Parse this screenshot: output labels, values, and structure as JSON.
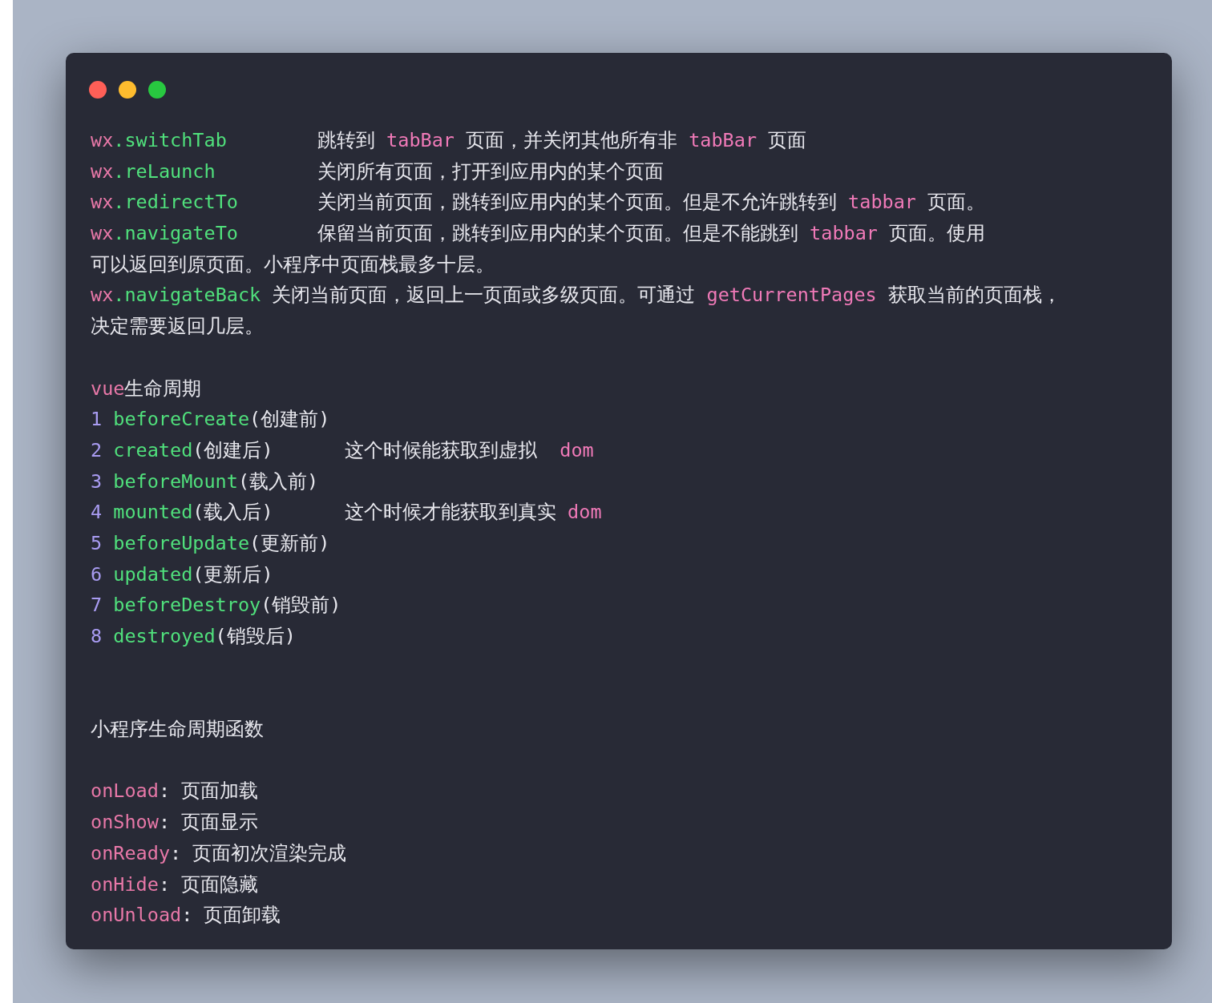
{
  "window": {
    "controls": [
      {
        "color": "#ff5f57"
      },
      {
        "color": "#febc2e"
      },
      {
        "color": "#28c840"
      }
    ]
  },
  "lines": [
    {
      "kind": "api",
      "lead": [
        {
          "text": "wx",
          "kind": "object"
        },
        {
          "text": ".switchTab",
          "kind": "method"
        }
      ],
      "rest": [
        {
          "text": "跳转到",
          "kind": "text"
        },
        {
          "text": "tabBar",
          "kind": "code"
        },
        {
          "text": "页面，并关闭其他所有非",
          "kind": "text"
        },
        {
          "text": "tabBar",
          "kind": "code"
        },
        {
          "text": "页面",
          "kind": "text"
        }
      ]
    },
    {
      "kind": "api",
      "lead": [
        {
          "text": "wx",
          "kind": "object"
        },
        {
          "text": ".reLaunch",
          "kind": "method"
        }
      ],
      "rest": [
        {
          "text": "关闭所有页面，打开到应用内的某个页面",
          "kind": "text"
        }
      ]
    },
    {
      "kind": "api",
      "lead": [
        {
          "text": "wx",
          "kind": "object"
        },
        {
          "text": ".redirectTo",
          "kind": "method"
        }
      ],
      "rest": [
        {
          "text": "关闭当前页面，跳转到应用内的某个页面。但是不允许跳转到",
          "kind": "text"
        },
        {
          "text": "tabbar",
          "kind": "code"
        },
        {
          "text": "页面。",
          "kind": "text"
        }
      ]
    },
    {
      "kind": "api",
      "lead": [
        {
          "text": "wx",
          "kind": "object"
        },
        {
          "text": ".navigateTo",
          "kind": "method"
        }
      ],
      "rest": [
        {
          "text": "保留当前页面，跳转到应用内的某个页面。但是不能跳到",
          "kind": "text"
        },
        {
          "text": "tabbar",
          "kind": "code"
        },
        {
          "text": "页面。使用",
          "kind": "text"
        }
      ]
    },
    {
      "kind": "plain",
      "lead": [
        {
          "text": "可以返回到原页面。小程序中页面栈最多十层。",
          "kind": "text"
        }
      ]
    },
    {
      "kind": "plain",
      "lead": [
        {
          "text": "wx",
          "kind": "object"
        },
        {
          "text": ".navigateBack",
          "kind": "method"
        },
        {
          "text": " 关闭当前页面，返回上一页面或多级页面。可通过",
          "kind": "text"
        },
        {
          "text": "getCurrentPages",
          "kind": "code"
        },
        {
          "text": "获取当前的页面栈，",
          "kind": "text"
        }
      ]
    },
    {
      "kind": "plain",
      "lead": [
        {
          "text": "决定需要返回几层。",
          "kind": "text"
        }
      ]
    },
    {
      "kind": "blank"
    },
    {
      "kind": "plain",
      "lead": [
        {
          "text": "vue",
          "kind": "object"
        },
        {
          "text": "生命周期",
          "kind": "text"
        }
      ]
    },
    {
      "kind": "hook",
      "lead": [
        {
          "text": "1",
          "kind": "index"
        },
        {
          "text": "beforeCreate",
          "kind": "method"
        },
        {
          "text": "(创建前)",
          "kind": "text"
        }
      ]
    },
    {
      "kind": "hook",
      "lead": [
        {
          "text": "2",
          "kind": "index"
        },
        {
          "text": "created",
          "kind": "method"
        },
        {
          "text": "(创建后)",
          "kind": "text"
        }
      ],
      "rest": [
        {
          "text": "这个时候能获取到虚拟 ",
          "kind": "text"
        },
        {
          "text": "dom",
          "kind": "code"
        }
      ]
    },
    {
      "kind": "hook",
      "lead": [
        {
          "text": "3",
          "kind": "index"
        },
        {
          "text": "beforeMount",
          "kind": "method"
        },
        {
          "text": "(载入前)",
          "kind": "text"
        }
      ]
    },
    {
      "kind": "hook",
      "lead": [
        {
          "text": "4",
          "kind": "index"
        },
        {
          "text": "mounted",
          "kind": "method"
        },
        {
          "text": "(载入后)",
          "kind": "text"
        }
      ],
      "rest": [
        {
          "text": "这个时候才能获取到真实",
          "kind": "text"
        },
        {
          "text": "dom",
          "kind": "code"
        }
      ]
    },
    {
      "kind": "hook",
      "lead": [
        {
          "text": "5",
          "kind": "index"
        },
        {
          "text": "beforeUpdate",
          "kind": "method"
        },
        {
          "text": "(更新前)",
          "kind": "text"
        }
      ]
    },
    {
      "kind": "hook",
      "lead": [
        {
          "text": "6",
          "kind": "index"
        },
        {
          "text": "updated",
          "kind": "method"
        },
        {
          "text": "(更新后)",
          "kind": "text"
        }
      ]
    },
    {
      "kind": "hook",
      "lead": [
        {
          "text": "7",
          "kind": "index"
        },
        {
          "text": "beforeDestroy",
          "kind": "method"
        },
        {
          "text": "(销毁前)",
          "kind": "text"
        }
      ]
    },
    {
      "kind": "hook",
      "lead": [
        {
          "text": "8",
          "kind": "index"
        },
        {
          "text": "destroyed",
          "kind": "method"
        },
        {
          "text": "(销毁后)",
          "kind": "text"
        }
      ]
    },
    {
      "kind": "blank"
    },
    {
      "kind": "blank"
    },
    {
      "kind": "plain",
      "lead": [
        {
          "text": "小程序生命周期函数",
          "kind": "text"
        }
      ]
    },
    {
      "kind": "blank"
    },
    {
      "kind": "plain",
      "lead": [
        {
          "text": "onLoad",
          "kind": "object"
        },
        {
          "text": ": 页面加载",
          "kind": "text"
        }
      ]
    },
    {
      "kind": "plain",
      "lead": [
        {
          "text": "onShow",
          "kind": "object"
        },
        {
          "text": ": 页面显示",
          "kind": "text"
        }
      ]
    },
    {
      "kind": "plain",
      "lead": [
        {
          "text": "onReady",
          "kind": "object"
        },
        {
          "text": ": 页面初次渲染完成",
          "kind": "text"
        }
      ]
    },
    {
      "kind": "plain",
      "lead": [
        {
          "text": "onHide",
          "kind": "object"
        },
        {
          "text": ": 页面隐藏",
          "kind": "text"
        }
      ]
    },
    {
      "kind": "plain",
      "lead": [
        {
          "text": "onUnload",
          "kind": "object"
        },
        {
          "text": ": 页面卸载",
          "kind": "text"
        }
      ]
    }
  ]
}
